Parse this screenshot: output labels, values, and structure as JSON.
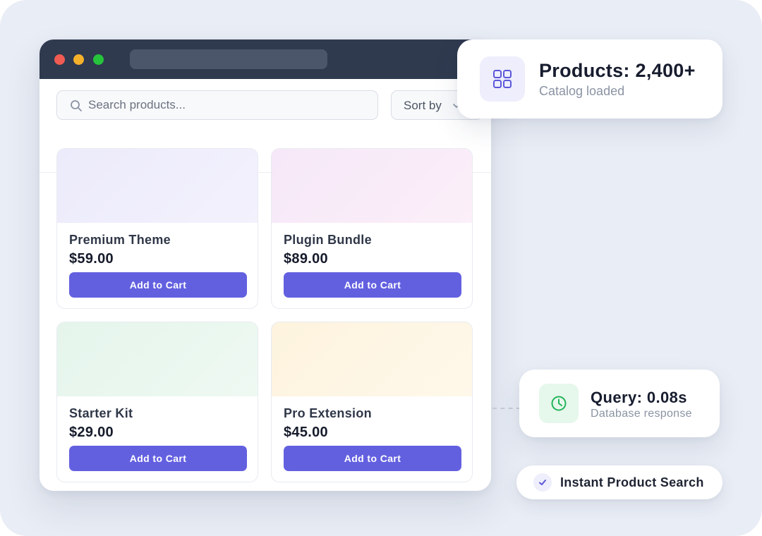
{
  "search": {
    "placeholder": "Search products..."
  },
  "sort": {
    "label": "Sort by"
  },
  "products": [
    {
      "name": "Premium Theme",
      "price": "$59.00",
      "button_label": "Add to Cart"
    },
    {
      "name": "Plugin Bundle",
      "price": "$89.00",
      "button_label": "Add to Cart"
    },
    {
      "name": "Starter Kit",
      "price": "$29.00",
      "button_label": "Add to Cart"
    },
    {
      "name": "Pro Extension",
      "price": "$45.00",
      "button_label": "Add to Cart"
    }
  ],
  "stats": {
    "products": {
      "headline": "Products: 2,400+",
      "subtitle": "Catalog loaded",
      "icon": "grid-icon"
    },
    "query": {
      "headline": "Query: 0.08s",
      "subtitle": "Database response",
      "icon": "clock-icon"
    }
  },
  "feature_pill": {
    "label": "Instant Product Search",
    "icon": "check-icon"
  },
  "colors": {
    "accent": "#6360e0",
    "titlebar": "#2f3a4f",
    "background": "#e9edf5"
  }
}
